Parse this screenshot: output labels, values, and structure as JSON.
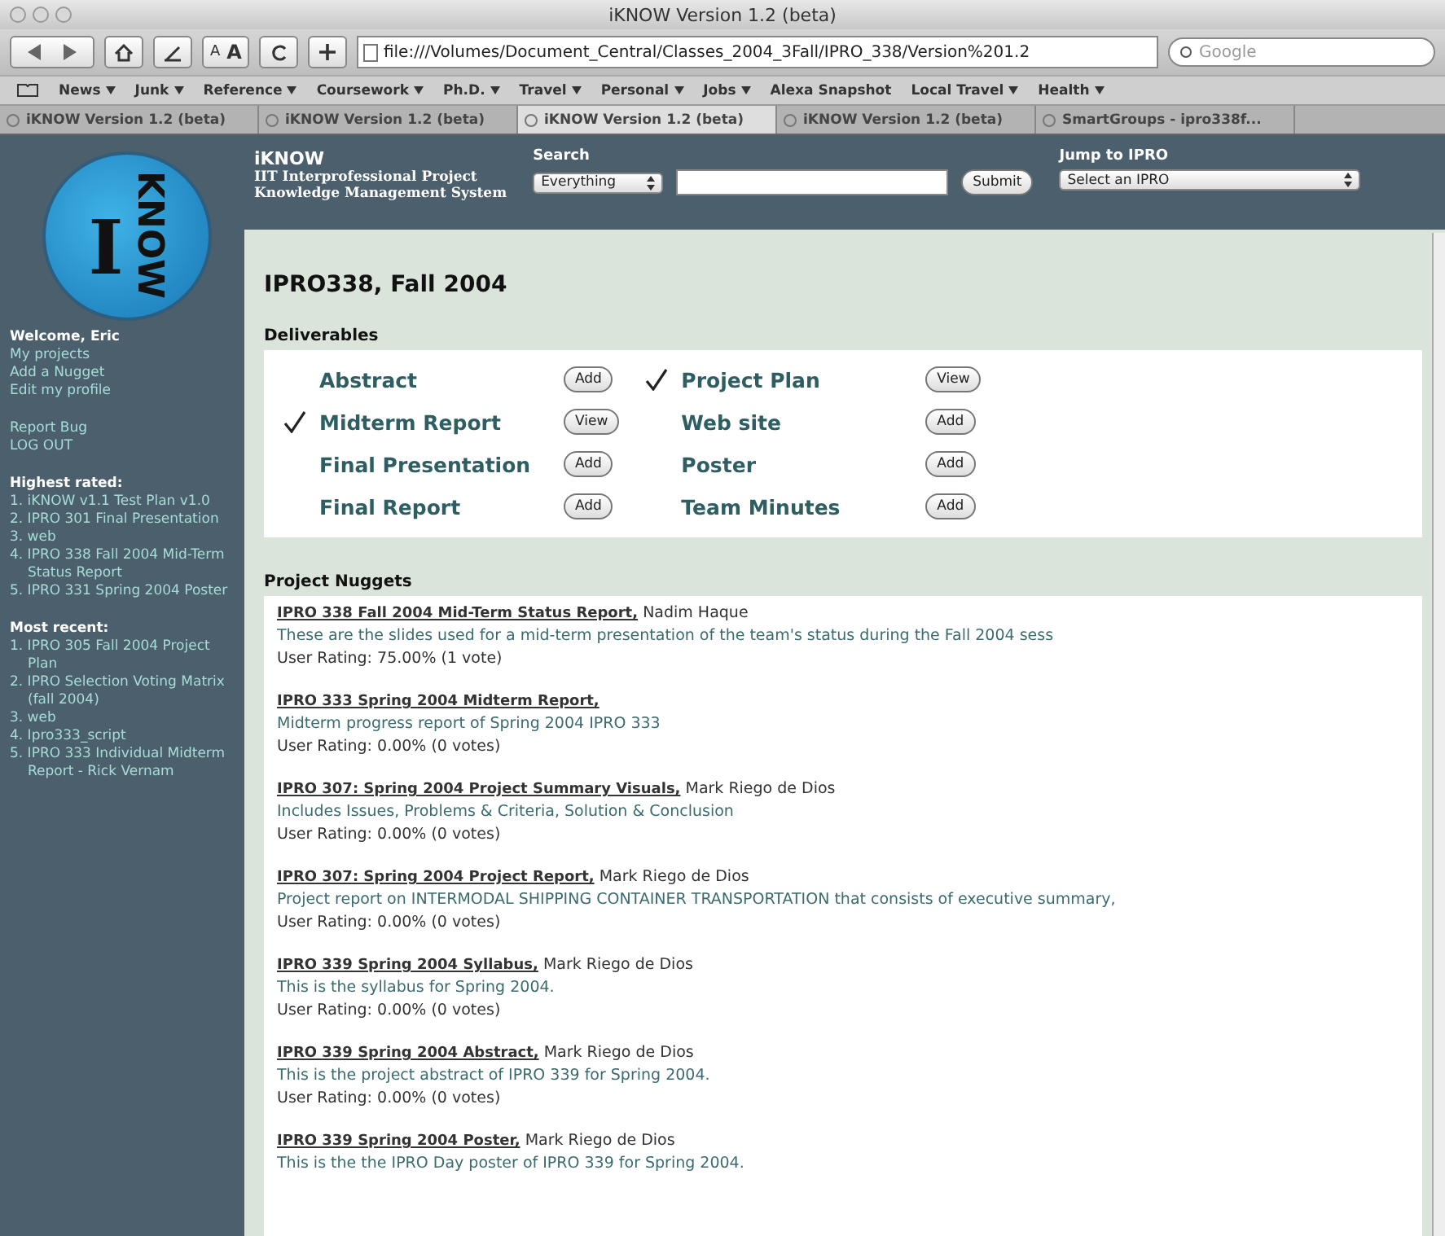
{
  "window": {
    "title": "iKNOW Version 1.2 (beta)"
  },
  "toolbar": {
    "text_size": [
      "A",
      "A"
    ],
    "url": "file:///Volumes/Document_Central/Classes_2004_3Fall/IPRO_338/Version%201.2",
    "search_placeholder": "Google"
  },
  "bookmarks": [
    {
      "label": "News",
      "menu": true
    },
    {
      "label": "Junk",
      "menu": true
    },
    {
      "label": "Reference",
      "menu": true
    },
    {
      "label": "Coursework",
      "menu": true
    },
    {
      "label": "Ph.D.",
      "menu": true
    },
    {
      "label": "Travel",
      "menu": true
    },
    {
      "label": "Personal",
      "menu": true
    },
    {
      "label": "Jobs",
      "menu": true
    },
    {
      "label": "Alexa Snapshot",
      "menu": false
    },
    {
      "label": "Local Travel",
      "menu": true
    },
    {
      "label": "Health",
      "menu": true
    }
  ],
  "tabs": [
    {
      "label": "iKNOW Version 1.2 (beta)",
      "selected": false
    },
    {
      "label": "iKNOW Version 1.2 (beta)",
      "selected": false
    },
    {
      "label": "iKNOW Version 1.2 (beta)",
      "selected": true
    },
    {
      "label": "iKNOW Version 1.2 (beta)",
      "selected": false
    },
    {
      "label": "SmartGroups - ipro338f...",
      "selected": false
    }
  ],
  "logo": {
    "letter": "I",
    "word": "KNOW"
  },
  "header": {
    "title": "iKNOW",
    "subtitle": [
      "IIT Interprofessional Project",
      "Knowledge Management System"
    ],
    "search_label": "Search",
    "search_scope": "Everything",
    "submit": "Submit",
    "jump_label": "Jump to IPRO",
    "jump_value": "Select an IPRO"
  },
  "sidebar": {
    "welcome": "Welcome, Eric",
    "links": [
      "My projects",
      "Add a Nugget",
      "Edit my profile"
    ],
    "links2": [
      "Report Bug",
      "LOG OUT"
    ],
    "sections": [
      {
        "title": "Highest rated:",
        "items": [
          "1. iKNOW v1.1 Test Plan v1.0",
          "2. IPRO 301 Final Presentation",
          "3. web",
          "4. IPRO 338 Fall 2004 Mid-Term Status Report",
          "5. IPRO 331 Spring 2004 Poster"
        ]
      },
      {
        "title": "Most recent:",
        "items": [
          "1. IPRO 305 Fall 2004 Project Plan",
          "2. IPRO Selection Voting Matrix (fall 2004)",
          "3. web",
          "4. Ipro333_script",
          "5. IPRO 333 Individual Midterm Report - Rick Vernam"
        ]
      }
    ]
  },
  "page_title": "IPRO338, Fall 2004",
  "deliverables": {
    "title": "Deliverables",
    "items": [
      {
        "label": "Abstract",
        "checked": false,
        "action": "Add"
      },
      {
        "label": "Project Plan",
        "checked": true,
        "action": "View"
      },
      {
        "label": "Midterm Report",
        "checked": true,
        "action": "View"
      },
      {
        "label": "Web site",
        "checked": false,
        "action": "Add"
      },
      {
        "label": "Final Presentation",
        "checked": false,
        "action": "Add"
      },
      {
        "label": "Poster",
        "checked": false,
        "action": "Add"
      },
      {
        "label": "Final Report",
        "checked": false,
        "action": "Add"
      },
      {
        "label": "Team Minutes",
        "checked": false,
        "action": "Add"
      }
    ]
  },
  "nuggets": {
    "title": "Project Nuggets",
    "items": [
      {
        "title": "IPRO 338 Fall 2004 Mid-Term Status Report,",
        "author": "Nadim Haque",
        "description": "These are the slides used for a mid-term presentation of the team's status during the Fall 2004 sess",
        "rating": "User Rating: 75.00% (1 vote)"
      },
      {
        "title": "IPRO 333 Spring 2004 Midterm Report,",
        "description": "Midterm progress report of Spring 2004 IPRO 333",
        "rating": "User Rating: 0.00% (0 votes)"
      },
      {
        "title": "IPRO 307: Spring 2004 Project Summary Visuals,",
        "author": "Mark Riego de Dios",
        "description": "Includes Issues, Problems & Criteria, Solution & Conclusion",
        "rating": "User Rating: 0.00% (0 votes)"
      },
      {
        "title": "IPRO 307: Spring 2004 Project Report,",
        "author": "Mark Riego de Dios",
        "description": "Project report on INTERMODAL SHIPPING CONTAINER TRANSPORTATION that consists of executive summary,",
        "rating": "User Rating: 0.00% (0 votes)"
      },
      {
        "title": "IPRO 339 Spring 2004 Syllabus,",
        "author": "Mark Riego de Dios",
        "description": "This is the syllabus for Spring 2004.",
        "rating": "User Rating: 0.00% (0 votes)"
      },
      {
        "title": "IPRO 339 Spring 2004 Abstract,",
        "author": "Mark Riego de Dios",
        "description": "This is the project abstract of IPRO 339 for Spring 2004.",
        "rating": "User Rating: 0.00% (0 votes)"
      },
      {
        "title": "IPRO 339 Spring 2004 Poster,",
        "author": "Mark Riego de Dios",
        "description": "This is the the IPRO Day poster of IPRO 339 for Spring 2004."
      }
    ]
  }
}
